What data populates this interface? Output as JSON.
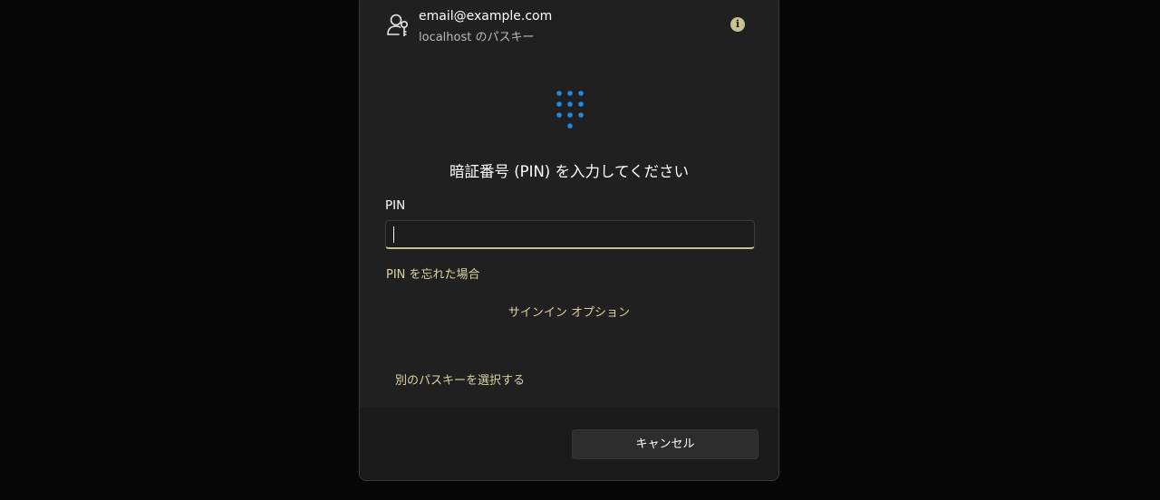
{
  "account": {
    "email": "email@example.com",
    "subtitle": "localhost のパスキー",
    "icon": "user-key-icon",
    "info_icon": "info-icon",
    "info_glyph": "i"
  },
  "prompt": {
    "icon": "keypad-icon",
    "title": "暗証番号 (PIN) を入力してください"
  },
  "pin": {
    "label": "PIN",
    "value": "",
    "forgot_link": "PIN を忘れた場合"
  },
  "signin_options": "サインイン オプション",
  "other_passkey": "別のパスキーを選択する",
  "footer": {
    "cancel_label": "キャンセル"
  },
  "colors": {
    "accent_link": "#dcd39f",
    "keypad_blue": "#1f8be0",
    "background": "#202020"
  }
}
